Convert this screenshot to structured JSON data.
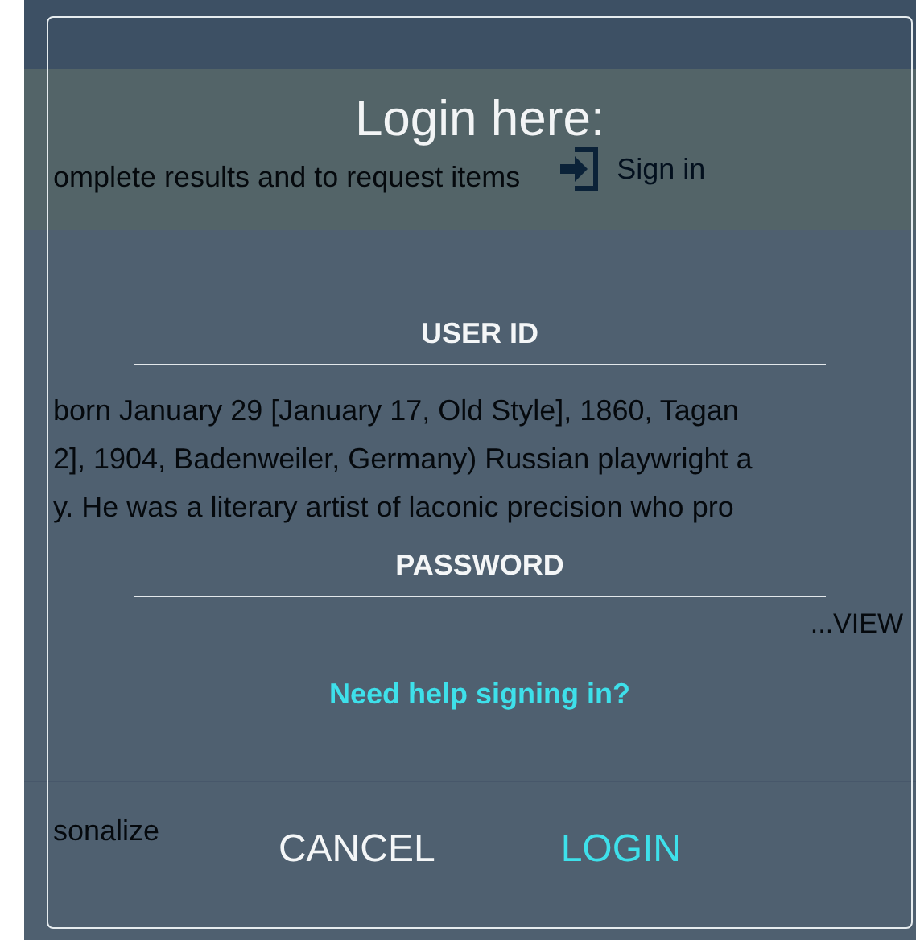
{
  "background_page": {
    "banner_text": "omplete results and to request items",
    "sign_in_link": "Sign in",
    "description_lines": [
      "born January 29 [January 17, Old Style], 1860, Tagan",
      "2], 1904, Badenweiler, Germany) Russian playwright a",
      "y. He was a literary artist of laconic precision who pro"
    ],
    "view_more_link": "...VIEW",
    "personalize_text": "sonalize"
  },
  "dialog": {
    "title": "Login here:",
    "fields": [
      {
        "placeholder": "USER ID"
      },
      {
        "placeholder": "PASSWORD"
      }
    ],
    "help_link": "Need help signing in?",
    "buttons": [
      {
        "label": "CANCEL",
        "kind": "secondary"
      },
      {
        "label": "LOGIN",
        "kind": "primary"
      }
    ]
  }
}
